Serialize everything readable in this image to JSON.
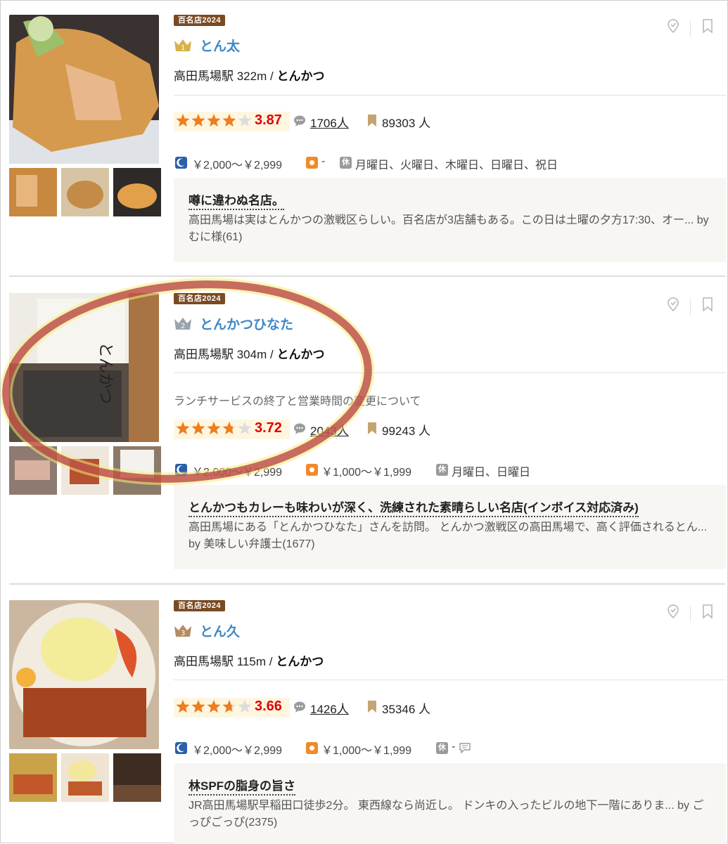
{
  "restaurants": [
    {
      "badge": "百名店2024",
      "rank": "1",
      "rank_color": "#d7b24a",
      "name": "とん太",
      "station_distance": "高田馬場駅 322m",
      "separator": "/",
      "genre": "とんかつ",
      "note": "",
      "rating": 3.87,
      "rating_text": "3.87",
      "review_count": "1706人",
      "bookmark_count": "89303 人",
      "dinner_price": "￥2,000～￥2,999",
      "lunch_price": "-",
      "closed_days": "月曜日、火曜日、木曜日、日曜日、祝日",
      "review_title": "噂に違わぬ名店。",
      "review_excerpt": "高田馬場は実はとんかつの激戦区らしい。百名店が3店舗もある。この日は土曜の夕方17:30、オー... by むに様(61)"
    },
    {
      "badge": "百名店2024",
      "rank": "2",
      "rank_color": "#9aa3ad",
      "name": "とんかつひなた",
      "station_distance": "高田馬場駅 304m",
      "separator": "/",
      "genre": "とんかつ",
      "note": "ランチサービスの終了と営業時間の変更について",
      "rating": 3.72,
      "rating_text": "3.72",
      "review_count": "2043人",
      "bookmark_count": "99243 人",
      "dinner_price": "￥2,000～￥2,999",
      "lunch_price": "￥1,000～￥1,999",
      "closed_days": "月曜日、日曜日",
      "review_title": "とんかつもカレーも味わいが深く、洗練された素晴らしい名店(インボイス対応済み)",
      "review_excerpt": "高田馬場にある「とんかつひなた」さんを訪問。 とんかつ激戦区の高田馬場で、高く評価されるとん... by 美味しい弁護士(1677)"
    },
    {
      "badge": "百名店2024",
      "rank": "3",
      "rank_color": "#b88a63",
      "name": "とん久",
      "station_distance": "高田馬場駅 115m",
      "separator": "/",
      "genre": "とんかつ",
      "note": "",
      "rating": 3.66,
      "rating_text": "3.66",
      "review_count": "1426人",
      "bookmark_count": "35346 人",
      "dinner_price": "￥2,000～￥2,999",
      "lunch_price": "￥1,000～￥1,999",
      "closed_days": "-",
      "review_title": "林SPFの脂身の旨さ",
      "review_excerpt": "JR高田馬場駅早稲田口徒歩2分。 東西線なら尚近し。 ドンキの入ったビルの地下一階にありま... by ごっぴごっぴ(2375)"
    }
  ],
  "colors": {
    "link": "#3f87c6",
    "score": "#e00000",
    "star": "#f07c1a",
    "badge_bg": "#7a4a21",
    "highlight_ring": "#b0323a"
  }
}
